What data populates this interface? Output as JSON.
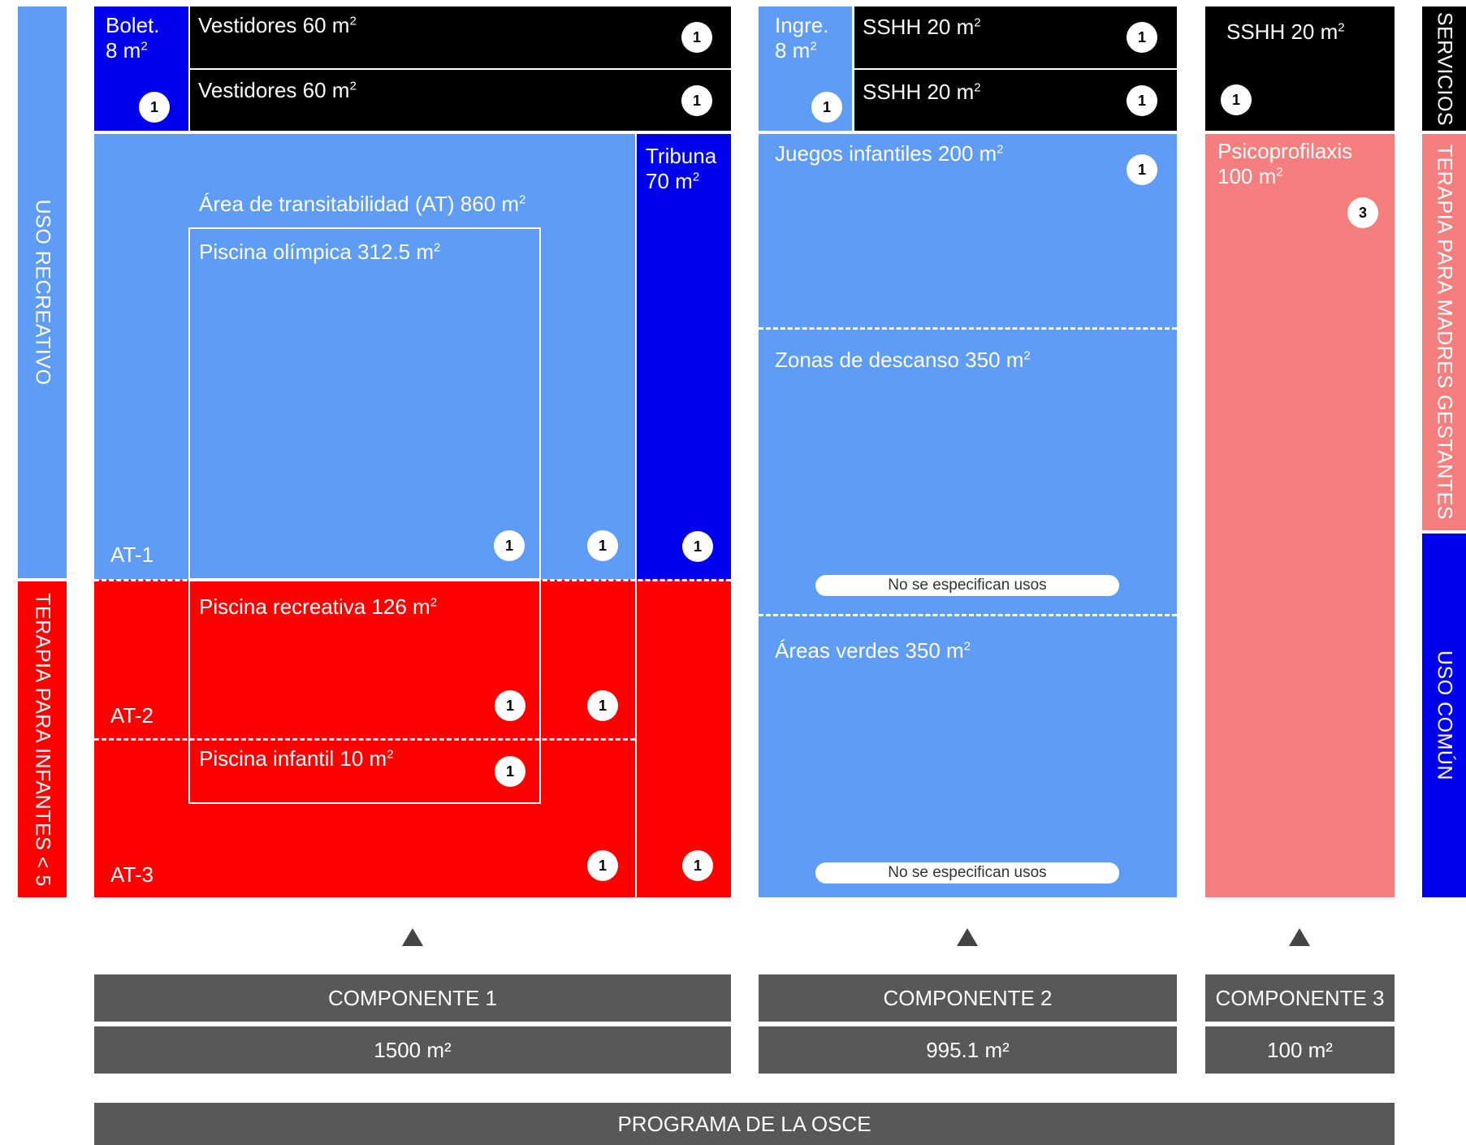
{
  "colors": {
    "light_blue": "#5f9cf5",
    "dark_blue": "#0000f0",
    "red": "#ff0000",
    "salmon": "#f57e7e",
    "black": "#000000",
    "gray_bar": "#585858"
  },
  "side_labels": {
    "uso_recreativo": "USO RECREATIVO",
    "terapia_infantes": "TERAPIA PARA INFANTES < 5",
    "servicios": "SERVICIOS",
    "terapia_madres": "TERAPIA PARA MADRES GESTANTES",
    "uso_comun": "USO COMÚN"
  },
  "component1": {
    "boletería": {
      "label": "Bolet.\n8 m",
      "badge": "1"
    },
    "vestidores_1": {
      "label": "Vestidores 60 m",
      "badge": "1"
    },
    "vestidores_2": {
      "label": "Vestidores 60 m",
      "badge": "1"
    },
    "tribuna": {
      "label": "Tribuna\n70 m",
      "badge": "1"
    },
    "area_transitabilidad": "Área de transitabilidad (AT) 860 m",
    "piscina_olimpica": {
      "label": "Piscina olímpica 312.5 m",
      "badge": "1"
    },
    "piscina_recreativa": {
      "label": "Piscina recreativa 126 m",
      "badge": "1"
    },
    "piscina_infantil": {
      "label": "Piscina infantil 10 m",
      "badge": "1"
    },
    "at1": {
      "label": "AT-1",
      "badge": "1"
    },
    "at2": {
      "label": "AT-2",
      "badge": "1"
    },
    "at3": {
      "label": "AT-3",
      "badge": "1"
    },
    "tribuna_red_badge": "1"
  },
  "component2": {
    "ingreso": {
      "label": "Ingre.\n8 m",
      "badge": "1"
    },
    "sshh_1": {
      "label": "SSHH 20 m",
      "badge": "1"
    },
    "sshh_2": {
      "label": "SSHH 20 m",
      "badge": "1"
    },
    "juegos": {
      "label": "Juegos infantiles 200 m",
      "badge": "1"
    },
    "zonas_descanso": {
      "label": "Zonas de descanso 350 m",
      "note": "No se especifican usos"
    },
    "areas_verdes": {
      "label": "Áreas verdes 350 m",
      "note": "No se especifican usos"
    }
  },
  "component3": {
    "sshh": {
      "label": "SSHH 20 m",
      "badge": "1"
    },
    "psicoprofilaxis": {
      "label": "Psicoprofilaxis\n100 m",
      "badge": "3"
    }
  },
  "superscript": "2",
  "bars": {
    "c1_title": "COMPONENTE 1",
    "c1_area": "1500 m²",
    "c2_title": "COMPONENTE 2",
    "c2_area": "995.1 m²",
    "c3_title": "COMPONENTE 3",
    "c3_area": "100 m²",
    "programa": "PROGRAMA DE LA OSCE"
  }
}
